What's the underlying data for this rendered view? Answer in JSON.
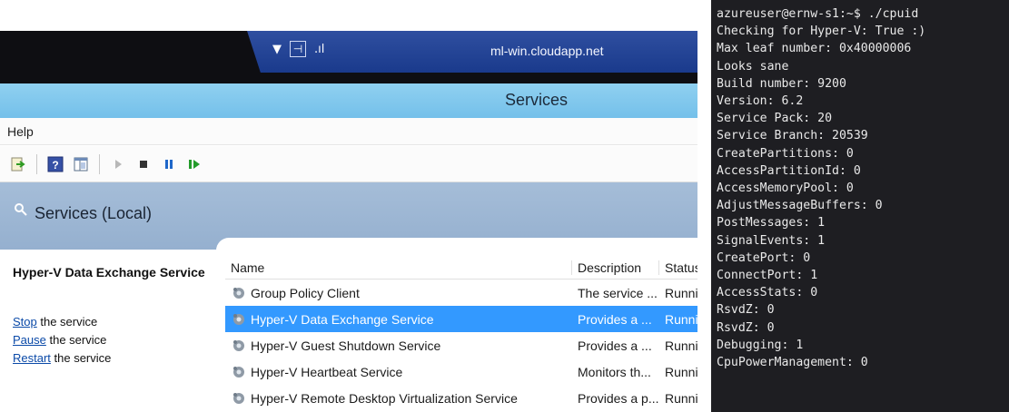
{
  "rdp": {
    "host": "ml-win.cloudapp.net",
    "pin_icon": "pin-icon",
    "signal_icon": "signal-icon",
    "dropdown_icon": "chevron-down-icon"
  },
  "window": {
    "title": "Services",
    "menu_help": "Help"
  },
  "toolbar": {
    "buttons": [
      "export-list-icon",
      "help-icon",
      "show-hide-pane-icon",
      "start-icon",
      "stop-icon",
      "pause-icon",
      "resume-icon"
    ]
  },
  "scope": {
    "title": "Services (Local)"
  },
  "details": {
    "service_name": "Hyper-V Data Exchange Service",
    "stop_link": "Stop",
    "stop_suffix": " the service",
    "pause_link": "Pause",
    "pause_suffix": " the service",
    "restart_link": "Restart",
    "restart_suffix": " the service"
  },
  "table": {
    "columns": {
      "name": "Name",
      "description": "Description",
      "status": "Status"
    },
    "rows": [
      {
        "name": "Group Policy Client",
        "description": "The service ...",
        "status": "Runni"
      },
      {
        "name": "Hyper-V Data Exchange Service",
        "description": "Provides a ...",
        "status": "Runni",
        "selected": true
      },
      {
        "name": "Hyper-V Guest Shutdown Service",
        "description": "Provides a ...",
        "status": "Runni"
      },
      {
        "name": "Hyper-V Heartbeat Service",
        "description": "Monitors th...",
        "status": "Runni"
      },
      {
        "name": "Hyper-V Remote Desktop Virtualization Service",
        "description": "Provides a p...",
        "status": "Runni"
      }
    ]
  },
  "terminal": {
    "lines": [
      "azureuser@ernw-s1:~$ ./cpuid",
      "Checking for Hyper-V: True :)",
      "Max leaf number: 0x40000006",
      "Looks sane",
      "Build number: 9200",
      "Version: 6.2",
      "Service Pack: 20",
      "Service Branch: 20539",
      "CreatePartitions: 0",
      "AccessPartitionId: 0",
      "AccessMemoryPool: 0",
      "AdjustMessageBuffers: 0",
      "PostMessages: 1",
      "SignalEvents: 1",
      "CreatePort: 0",
      "ConnectPort: 1",
      "AccessStats: 0",
      "RsvdZ: 0",
      "RsvdZ: 0",
      "Debugging: 1",
      "CpuPowerManagement: 0"
    ]
  }
}
